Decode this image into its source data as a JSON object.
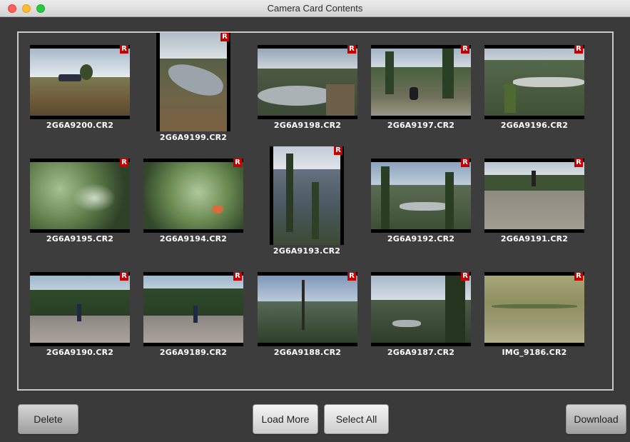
{
  "window": {
    "title": "Camera Card Contents"
  },
  "thumbnails": [
    {
      "filename": "2G6A9200.CR2",
      "badge": "R"
    },
    {
      "filename": "2G6A9199.CR2",
      "badge": "R"
    },
    {
      "filename": "2G6A9198.CR2",
      "badge": "R"
    },
    {
      "filename": "2G6A9197.CR2",
      "badge": "R"
    },
    {
      "filename": "2G6A9196.CR2",
      "badge": "R"
    },
    {
      "filename": "2G6A9195.CR2",
      "badge": "R"
    },
    {
      "filename": "2G6A9194.CR2",
      "badge": "R"
    },
    {
      "filename": "2G6A9193.CR2",
      "badge": "R"
    },
    {
      "filename": "2G6A9192.CR2",
      "badge": "R"
    },
    {
      "filename": "2G6A9191.CR2",
      "badge": "R"
    },
    {
      "filename": "2G6A9190.CR2",
      "badge": "R"
    },
    {
      "filename": "2G6A9189.CR2",
      "badge": "R"
    },
    {
      "filename": "2G6A9188.CR2",
      "badge": "R"
    },
    {
      "filename": "2G6A9187.CR2",
      "badge": "R"
    },
    {
      "filename": "IMG_9186.CR2",
      "badge": "R"
    }
  ],
  "buttons": {
    "delete": "Delete",
    "load_more": "Load More",
    "select_all": "Select All",
    "download": "Download"
  },
  "colors": {
    "raw_badge": "#c40000",
    "background": "#3a3a3a"
  }
}
